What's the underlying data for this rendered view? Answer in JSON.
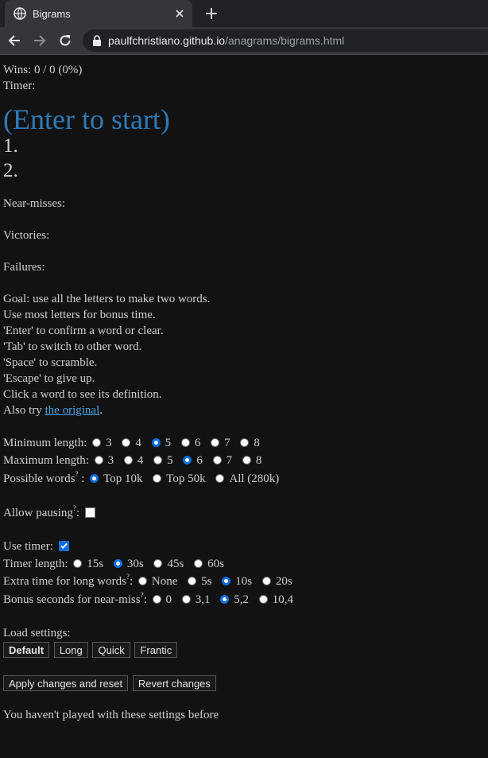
{
  "browser": {
    "tab_title": "Bigrams",
    "url_host": "paulfchristiano.github.io",
    "url_path": "/anagrams/bigrams.html"
  },
  "status": {
    "wins": "Wins: 0 / 0 (0%)",
    "timer": "Timer:"
  },
  "game": {
    "prompt": "(Enter to start)",
    "slot1": "1.",
    "slot2": "2."
  },
  "results": {
    "near_misses": "Near-misses:",
    "victories": "Victories:",
    "failures": "Failures:"
  },
  "instructions": [
    "Goal: use all the letters to make two words.",
    "Use most letters for bonus time.",
    "'Enter' to confirm a word or clear.",
    "'Tab' to switch to other word.",
    "'Space' to scramble.",
    "'Escape' to give up.",
    "Click a word to see its definition."
  ],
  "also_try": {
    "prefix": "Also try ",
    "link": "the original",
    "suffix": "."
  },
  "settings": {
    "min_length": {
      "label": "Minimum length:",
      "options": [
        "3",
        "4",
        "5",
        "6",
        "7",
        "8"
      ],
      "selected": "5"
    },
    "max_length": {
      "label": "Maximum length:",
      "options": [
        "3",
        "4",
        "5",
        "6",
        "7",
        "8"
      ],
      "selected": "6"
    },
    "possible_words": {
      "label": "Possible words",
      "sup": "?",
      "colon": " :",
      "options": [
        "Top 10k",
        "Top 50k",
        "All (280k)"
      ],
      "selected": "Top 10k"
    },
    "allow_pausing": {
      "label": "Allow pausing",
      "sup": "?",
      "colon": ":",
      "checked": false
    },
    "use_timer": {
      "label": "Use timer:",
      "checked": true
    },
    "timer_length": {
      "label": "Timer length:",
      "options": [
        "15s",
        "30s",
        "45s",
        "60s"
      ],
      "selected": "30s"
    },
    "extra_time": {
      "label": "Extra time for long words",
      "sup": "?",
      "colon": ":",
      "options": [
        "None",
        "5s",
        "10s",
        "20s"
      ],
      "selected": "10s"
    },
    "bonus_seconds": {
      "label": "Bonus seconds for near-miss",
      "sup": "?",
      "colon": ":",
      "options": [
        "0",
        "3,1",
        "5,2",
        "10,4"
      ],
      "selected": "5,2"
    }
  },
  "load_settings": {
    "label": "Load settings:",
    "presets": [
      "Default",
      "Long",
      "Quick",
      "Frantic"
    ]
  },
  "actions": {
    "apply": "Apply changes and reset",
    "revert": "Revert changes"
  },
  "footer_note": "You haven't played with these settings before",
  "colors": {
    "accent": "#2d7bb8",
    "background": "#121212",
    "text": "#cfcfcf",
    "radio_selected": "#0b6ee0"
  }
}
